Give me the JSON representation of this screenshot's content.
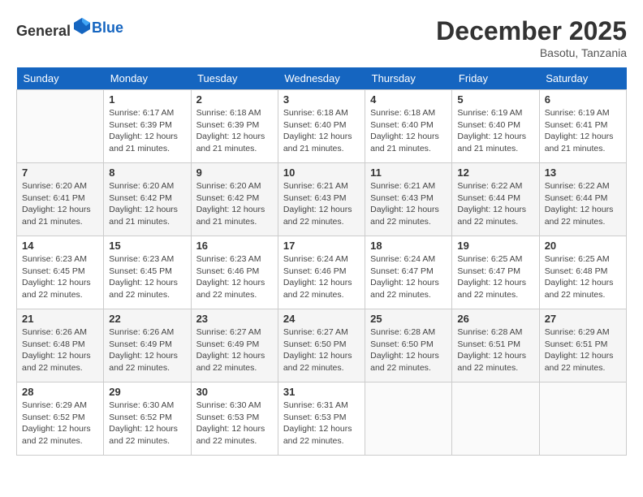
{
  "header": {
    "logo": {
      "general": "General",
      "blue": "Blue"
    },
    "title": "December 2025",
    "location": "Basotu, Tanzania"
  },
  "calendar": {
    "weekdays": [
      "Sunday",
      "Monday",
      "Tuesday",
      "Wednesday",
      "Thursday",
      "Friday",
      "Saturday"
    ],
    "weeks": [
      [
        {
          "day": null
        },
        {
          "day": 1,
          "sunrise": "6:17 AM",
          "sunset": "6:39 PM",
          "daylight": "12 hours and 21 minutes."
        },
        {
          "day": 2,
          "sunrise": "6:18 AM",
          "sunset": "6:39 PM",
          "daylight": "12 hours and 21 minutes."
        },
        {
          "day": 3,
          "sunrise": "6:18 AM",
          "sunset": "6:40 PM",
          "daylight": "12 hours and 21 minutes."
        },
        {
          "day": 4,
          "sunrise": "6:18 AM",
          "sunset": "6:40 PM",
          "daylight": "12 hours and 21 minutes."
        },
        {
          "day": 5,
          "sunrise": "6:19 AM",
          "sunset": "6:40 PM",
          "daylight": "12 hours and 21 minutes."
        },
        {
          "day": 6,
          "sunrise": "6:19 AM",
          "sunset": "6:41 PM",
          "daylight": "12 hours and 21 minutes."
        }
      ],
      [
        {
          "day": 7,
          "sunrise": "6:20 AM",
          "sunset": "6:41 PM",
          "daylight": "12 hours and 21 minutes."
        },
        {
          "day": 8,
          "sunrise": "6:20 AM",
          "sunset": "6:42 PM",
          "daylight": "12 hours and 21 minutes."
        },
        {
          "day": 9,
          "sunrise": "6:20 AM",
          "sunset": "6:42 PM",
          "daylight": "12 hours and 21 minutes."
        },
        {
          "day": 10,
          "sunrise": "6:21 AM",
          "sunset": "6:43 PM",
          "daylight": "12 hours and 22 minutes."
        },
        {
          "day": 11,
          "sunrise": "6:21 AM",
          "sunset": "6:43 PM",
          "daylight": "12 hours and 22 minutes."
        },
        {
          "day": 12,
          "sunrise": "6:22 AM",
          "sunset": "6:44 PM",
          "daylight": "12 hours and 22 minutes."
        },
        {
          "day": 13,
          "sunrise": "6:22 AM",
          "sunset": "6:44 PM",
          "daylight": "12 hours and 22 minutes."
        }
      ],
      [
        {
          "day": 14,
          "sunrise": "6:23 AM",
          "sunset": "6:45 PM",
          "daylight": "12 hours and 22 minutes."
        },
        {
          "day": 15,
          "sunrise": "6:23 AM",
          "sunset": "6:45 PM",
          "daylight": "12 hours and 22 minutes."
        },
        {
          "day": 16,
          "sunrise": "6:23 AM",
          "sunset": "6:46 PM",
          "daylight": "12 hours and 22 minutes."
        },
        {
          "day": 17,
          "sunrise": "6:24 AM",
          "sunset": "6:46 PM",
          "daylight": "12 hours and 22 minutes."
        },
        {
          "day": 18,
          "sunrise": "6:24 AM",
          "sunset": "6:47 PM",
          "daylight": "12 hours and 22 minutes."
        },
        {
          "day": 19,
          "sunrise": "6:25 AM",
          "sunset": "6:47 PM",
          "daylight": "12 hours and 22 minutes."
        },
        {
          "day": 20,
          "sunrise": "6:25 AM",
          "sunset": "6:48 PM",
          "daylight": "12 hours and 22 minutes."
        }
      ],
      [
        {
          "day": 21,
          "sunrise": "6:26 AM",
          "sunset": "6:48 PM",
          "daylight": "12 hours and 22 minutes."
        },
        {
          "day": 22,
          "sunrise": "6:26 AM",
          "sunset": "6:49 PM",
          "daylight": "12 hours and 22 minutes."
        },
        {
          "day": 23,
          "sunrise": "6:27 AM",
          "sunset": "6:49 PM",
          "daylight": "12 hours and 22 minutes."
        },
        {
          "day": 24,
          "sunrise": "6:27 AM",
          "sunset": "6:50 PM",
          "daylight": "12 hours and 22 minutes."
        },
        {
          "day": 25,
          "sunrise": "6:28 AM",
          "sunset": "6:50 PM",
          "daylight": "12 hours and 22 minutes."
        },
        {
          "day": 26,
          "sunrise": "6:28 AM",
          "sunset": "6:51 PM",
          "daylight": "12 hours and 22 minutes."
        },
        {
          "day": 27,
          "sunrise": "6:29 AM",
          "sunset": "6:51 PM",
          "daylight": "12 hours and 22 minutes."
        }
      ],
      [
        {
          "day": 28,
          "sunrise": "6:29 AM",
          "sunset": "6:52 PM",
          "daylight": "12 hours and 22 minutes."
        },
        {
          "day": 29,
          "sunrise": "6:30 AM",
          "sunset": "6:52 PM",
          "daylight": "12 hours and 22 minutes."
        },
        {
          "day": 30,
          "sunrise": "6:30 AM",
          "sunset": "6:53 PM",
          "daylight": "12 hours and 22 minutes."
        },
        {
          "day": 31,
          "sunrise": "6:31 AM",
          "sunset": "6:53 PM",
          "daylight": "12 hours and 22 minutes."
        },
        {
          "day": null
        },
        {
          "day": null
        },
        {
          "day": null
        }
      ]
    ]
  }
}
